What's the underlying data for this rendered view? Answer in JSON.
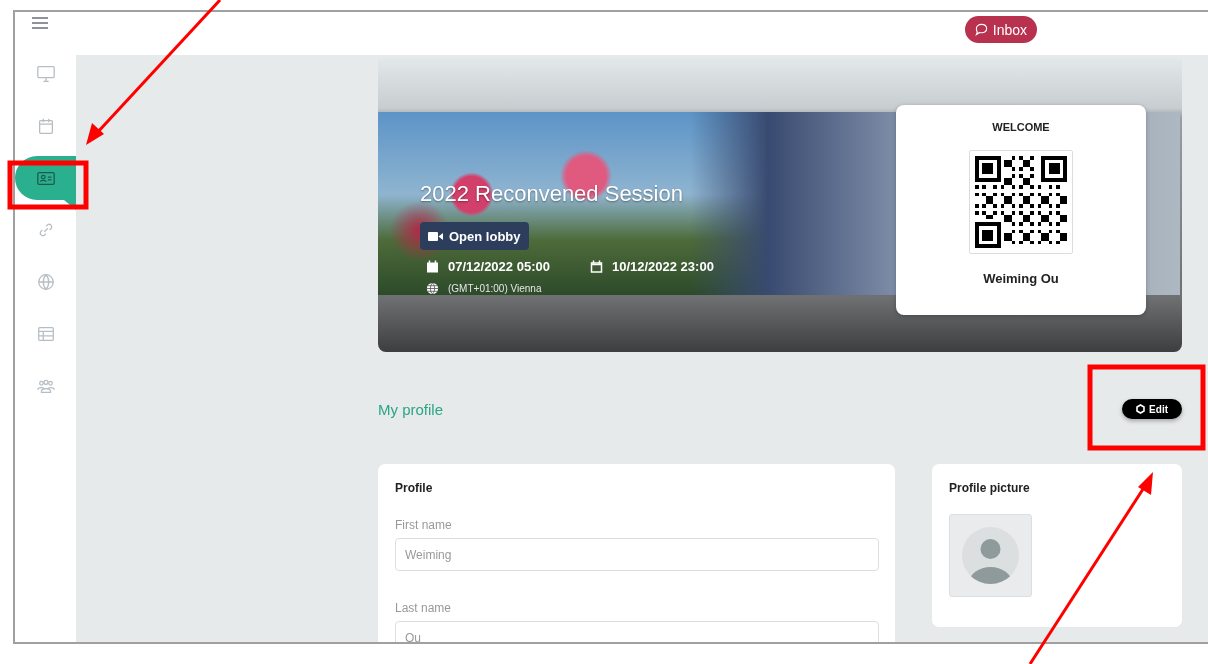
{
  "header": {
    "inbox_button": "Inbox"
  },
  "sidebar": {
    "items": [
      {
        "selected": false
      },
      {
        "selected": false
      },
      {
        "selected": true
      },
      {
        "selected": false
      },
      {
        "selected": false
      },
      {
        "selected": false
      },
      {
        "selected": false
      }
    ]
  },
  "event": {
    "title": "2022 Reconvened Session",
    "lobby_button": "Open lobby",
    "start": "07/12/2022 05:00",
    "end": "10/12/2022 23:00",
    "timezone": "(GMT+01:00) Vienna"
  },
  "welcome_card": {
    "heading": "WELCOME",
    "name": "Weiming Ou"
  },
  "profile": {
    "heading": "My profile",
    "edit_button": "Edit",
    "card_title": "Profile",
    "fields": [
      {
        "label": "First name",
        "value": "Weiming"
      },
      {
        "label": "Last name",
        "value": "Ou"
      }
    ],
    "picture_card_title": "Profile picture"
  }
}
